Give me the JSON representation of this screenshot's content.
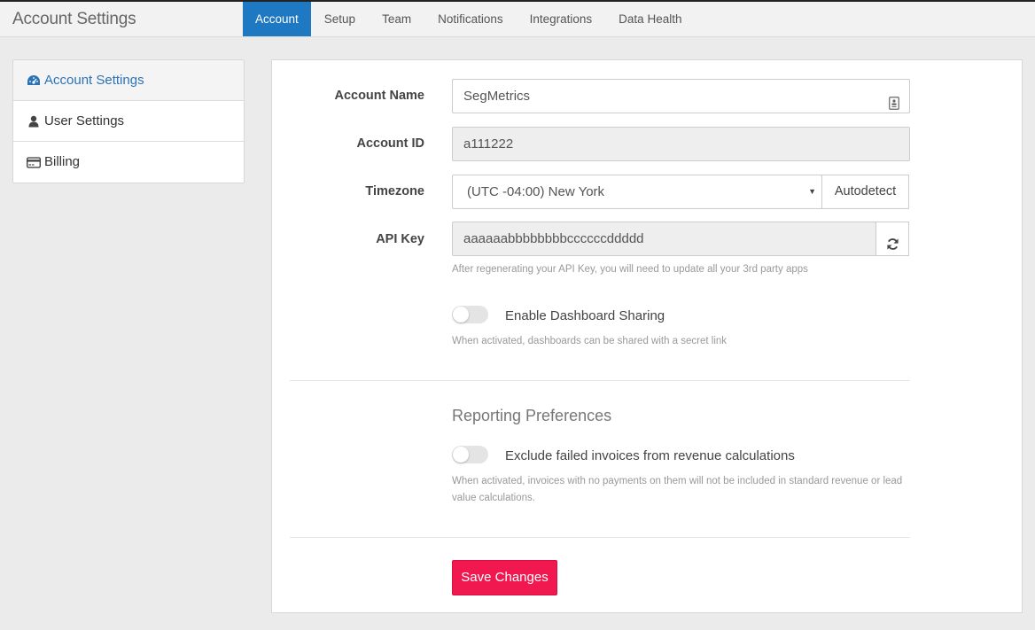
{
  "header": {
    "title": "Account Settings",
    "tabs": [
      {
        "label": "Account",
        "active": true
      },
      {
        "label": "Setup"
      },
      {
        "label": "Team"
      },
      {
        "label": "Notifications"
      },
      {
        "label": "Integrations"
      },
      {
        "label": "Data Health"
      }
    ]
  },
  "sidebar": {
    "items": [
      {
        "label": "Account Settings",
        "icon": "dashboard-icon",
        "active": true
      },
      {
        "label": "User Settings",
        "icon": "user-icon"
      },
      {
        "label": "Billing",
        "icon": "credit-card-icon"
      }
    ]
  },
  "form": {
    "account_name": {
      "label": "Account Name",
      "value": "SegMetrics",
      "icon": "contact-card-icon"
    },
    "account_id": {
      "label": "Account ID",
      "value": "a111222"
    },
    "timezone": {
      "label": "Timezone",
      "value": "(UTC -04:00) New York",
      "autodetect_label": "Autodetect"
    },
    "api_key": {
      "label": "API Key",
      "value": "aaaaaabbbbbbbbccccccddddd",
      "refresh_icon": "refresh-icon",
      "help": "After regenerating your API Key, you will need to update all your 3rd party apps"
    },
    "dashboard_sharing": {
      "label": "Enable Dashboard Sharing",
      "enabled": false,
      "help": "When activated, dashboards can be shared with a secret link"
    },
    "reporting": {
      "title": "Reporting Preferences",
      "exclude_failed": {
        "label": "Exclude failed invoices from revenue calculations",
        "enabled": false,
        "help_line1": "When activated, invoices with no payments on them will not be included in standard revenue or lead",
        "help_line2": "value calculations."
      }
    },
    "save_label": "Save Changes"
  },
  "colors": {
    "accent": "#1e78c2",
    "save_button": "#f0184f",
    "sidebar_active_text": "#2a73b8"
  }
}
